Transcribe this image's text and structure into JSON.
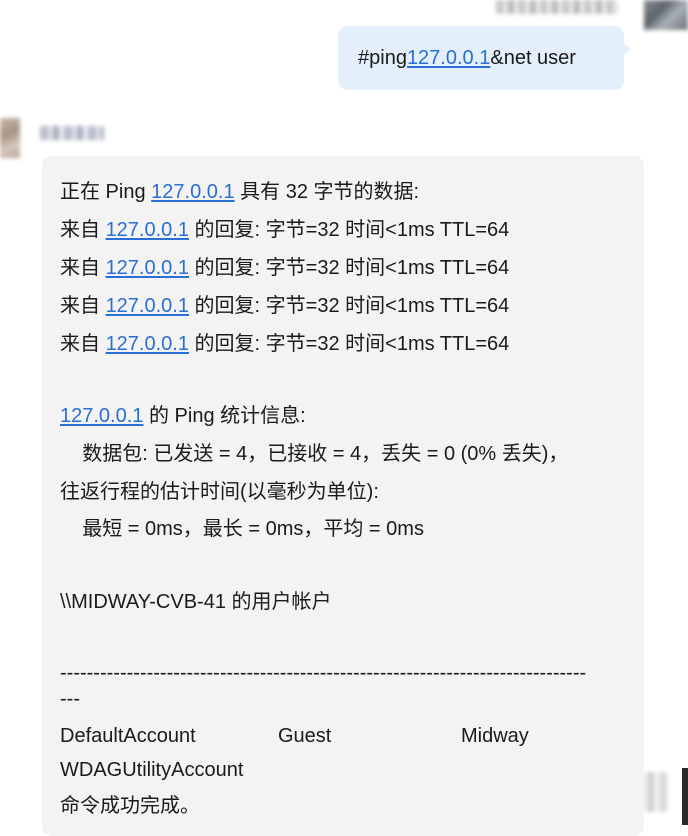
{
  "user_message": {
    "prefix": "#ping ",
    "link": "127.0.0.1",
    "suffix": "&net user"
  },
  "reply": {
    "ping_header": {
      "pre": "正在 Ping ",
      "ip": "127.0.0.1",
      "post": " 具有 32 字节的数据:"
    },
    "replies": [
      {
        "pre": "来自 ",
        "ip": "127.0.0.1",
        "post": " 的回复: 字节=32 时间<1ms TTL=64"
      },
      {
        "pre": "来自 ",
        "ip": "127.0.0.1",
        "post": " 的回复: 字节=32 时间<1ms TTL=64"
      },
      {
        "pre": "来自 ",
        "ip": "127.0.0.1",
        "post": " 的回复: 字节=32 时间<1ms TTL=64"
      },
      {
        "pre": "来自 ",
        "ip": "127.0.0.1",
        "post": " 的回复: 字节=32 时间<1ms TTL=64"
      }
    ],
    "stats_title": {
      "ip": "127.0.0.1",
      "post": " 的 Ping 统计信息:"
    },
    "packets": "    数据包: 已发送 = 4，已接收 = 4，丢失 = 0 (0% 丢失)，",
    "rtt_title": "往返行程的估计时间(以毫秒为单位):",
    "rtt_values": "    最短 = 0ms，最长 = 0ms，平均 = 0ms",
    "account_title": "\\\\MIDWAY-CVB-41 的用户帐户",
    "separator": "-------------------------------------------------------------------------------",
    "separator_tail": "---",
    "accounts": [
      "DefaultAccount",
      "Guest",
      "Midway"
    ],
    "accounts_line2": "WDAGUtilityAccount",
    "completion": "命令成功完成。"
  }
}
